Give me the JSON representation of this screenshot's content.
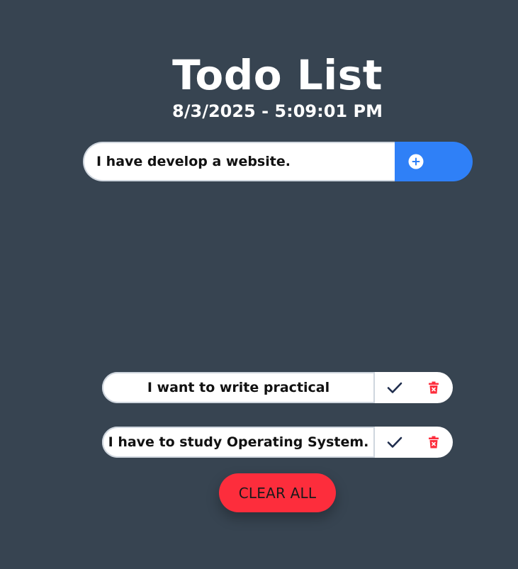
{
  "header": {
    "title": "Todo List",
    "datetime": "8/3/2025 - 5:09:01 PM"
  },
  "form": {
    "input_value": "I have develop a website.",
    "add_icon": "plus-circle-icon"
  },
  "todos": [
    {
      "text": "I want to write practical",
      "check_icon": "check-icon",
      "delete_icon": "trash-icon"
    },
    {
      "text": "I have to study Operating System.",
      "check_icon": "check-icon",
      "delete_icon": "trash-icon"
    }
  ],
  "clear_button": {
    "label": "CLEAR ALL"
  },
  "colors": {
    "background": "#374451",
    "accent": "#2f80f7",
    "danger": "#fd2d3c",
    "check": "#1f2d4d"
  }
}
